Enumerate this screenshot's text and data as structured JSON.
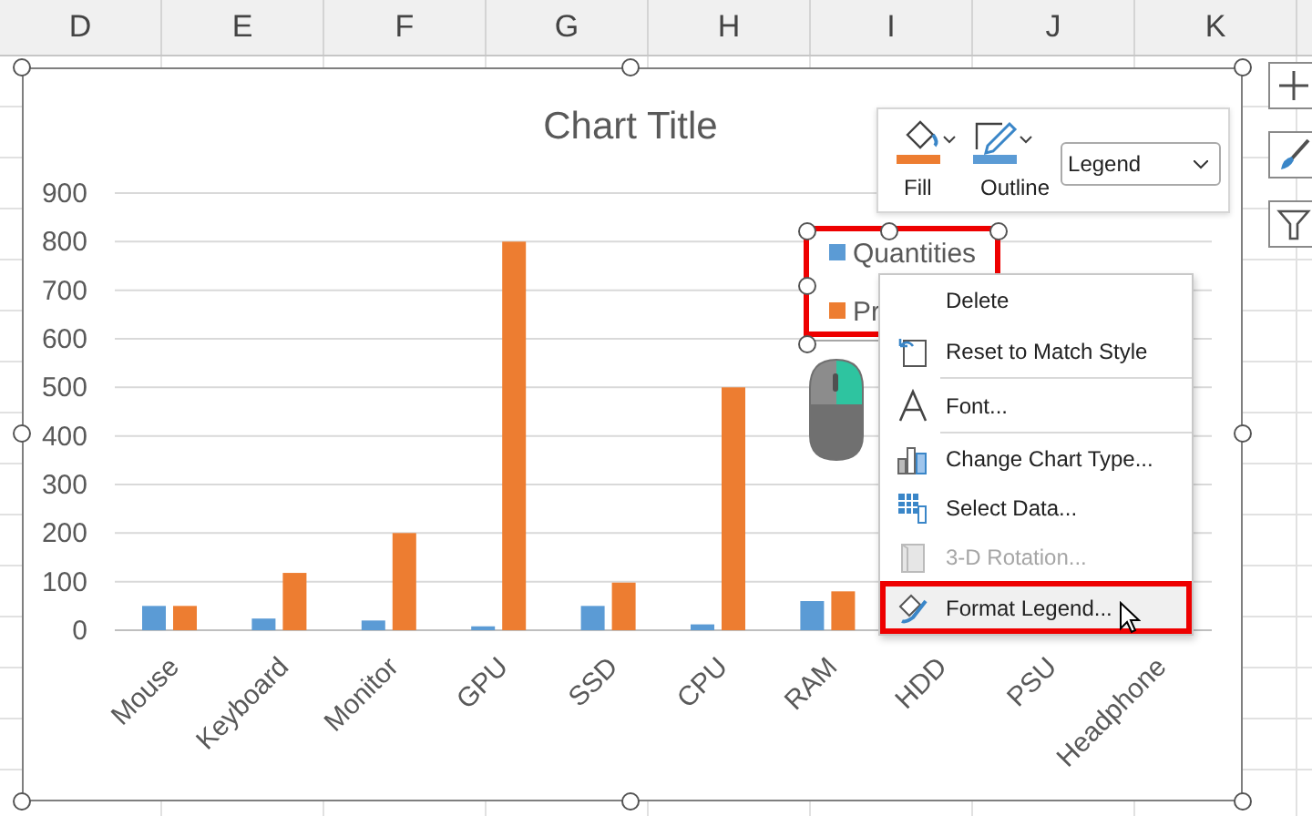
{
  "columns": [
    "D",
    "E",
    "F",
    "G",
    "H",
    "I",
    "J",
    "K"
  ],
  "chart": {
    "chart_data": {
      "type": "bar",
      "title": "Chart Title",
      "categories": [
        "Mouse",
        "Keyboard",
        "Monitor",
        "GPU",
        "SSD",
        "CPU",
        "RAM",
        "HDD",
        "PSU",
        "Headphone"
      ],
      "series": [
        {
          "name": "Quantities",
          "color": "#5b9bd5",
          "values": [
            50,
            24,
            20,
            8,
            50,
            12,
            60,
            null,
            null,
            null
          ]
        },
        {
          "name": "Pr",
          "color": "#ed7d31",
          "values": [
            50,
            118,
            200,
            800,
            98,
            500,
            80,
            null,
            null,
            null
          ]
        }
      ],
      "ylim": [
        0,
        900
      ],
      "grid": true,
      "legend": true,
      "yticks": [
        0,
        100,
        200,
        300,
        400,
        500,
        600,
        700,
        800,
        900
      ]
    },
    "legend": {
      "selected": true,
      "annotated": true
    }
  },
  "format_toolbar": {
    "fill_label": "Fill",
    "outline_label": "Outline",
    "element_select": "Legend"
  },
  "context_menu": [
    {
      "label": "Delete",
      "disabled": false,
      "selected": false,
      "separator_after": false,
      "annotated": false
    },
    {
      "label": "Reset to Match Style",
      "disabled": false,
      "selected": false,
      "separator_after": true,
      "annotated": false
    },
    {
      "label": "Font...",
      "disabled": false,
      "selected": false,
      "separator_after": true,
      "annotated": false
    },
    {
      "label": "Change Chart Type...",
      "disabled": false,
      "selected": false,
      "separator_after": false,
      "annotated": false
    },
    {
      "label": "Select Data...",
      "disabled": false,
      "selected": false,
      "separator_after": false,
      "annotated": false
    },
    {
      "label": "3-D Rotation...",
      "disabled": true,
      "selected": false,
      "separator_after": false,
      "annotated": false
    },
    {
      "label": "Format Legend...",
      "disabled": false,
      "selected": true,
      "separator_after": false,
      "annotated": true
    }
  ]
}
